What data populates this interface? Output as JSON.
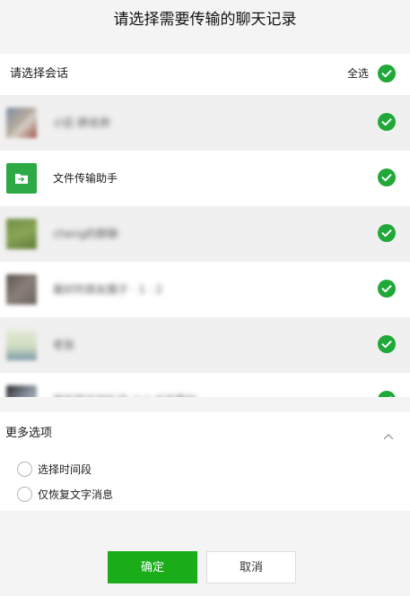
{
  "dialog": {
    "title": "请选择需要传输的聊天记录"
  },
  "header": {
    "label": "请选择会话",
    "select_all": "全选"
  },
  "conversations": [
    {
      "name": "小区·群名称",
      "blurred": true,
      "avatar": "photo-avatar-1",
      "checked": true
    },
    {
      "name": "文件传输助手",
      "blurred": false,
      "avatar": "file-transfer-icon",
      "checked": true
    },
    {
      "name": "cheng的群聊",
      "blurred": true,
      "avatar": "photo-avatar-3",
      "checked": true
    },
    {
      "name": "最好的朋友圈子 · 1 · 2",
      "blurred": true,
      "avatar": "photo-avatar-4",
      "checked": true
    },
    {
      "name": "老张",
      "blurred": true,
      "avatar": "photo-avatar-5",
      "checked": true
    },
    {
      "name": "那年那天的队伍·小心点不要怕",
      "blurred": true,
      "avatar": "photo-avatar-6",
      "checked": true
    }
  ],
  "more_options": {
    "title": "更多选项",
    "options": [
      {
        "label": "选择时间段",
        "checked": false
      },
      {
        "label": "仅恢复文字消息",
        "checked": false
      }
    ]
  },
  "buttons": {
    "confirm": "确定",
    "cancel": "取消"
  },
  "colors": {
    "accent_green": "#20a839",
    "button_green": "#1aad19"
  }
}
